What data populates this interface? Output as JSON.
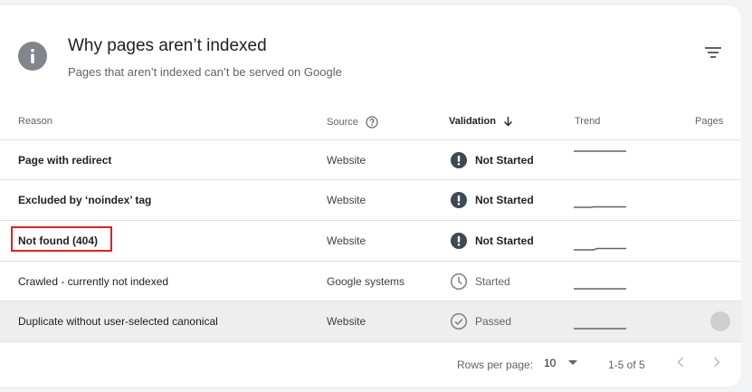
{
  "card": {
    "title": "Why pages aren’t indexed",
    "subtitle": "Pages that aren’t indexed can’t be served on Google",
    "info_icon": "info-icon",
    "filter_icon": "filter-icon"
  },
  "table": {
    "headers": {
      "reason": "Reason",
      "source": "Source",
      "validation": "Validation",
      "trend": "Trend",
      "pages": "Pages"
    },
    "rows": [
      {
        "reason": "Page with redirect",
        "source": "Website",
        "validation": "Not Started",
        "status_icon": "alert-icon"
      },
      {
        "reason": "Excluded by ‘noindex’ tag",
        "source": "Website",
        "validation": "Not Started",
        "status_icon": "alert-icon"
      },
      {
        "reason": "Not found (404)",
        "source": "Website",
        "validation": "Not Started",
        "status_icon": "alert-icon"
      },
      {
        "reason": "Crawled - currently not indexed",
        "source": "Google systems",
        "validation": "Started",
        "status_icon": "clock-icon"
      },
      {
        "reason": "Duplicate without user-selected canonical",
        "source": "Website",
        "validation": "Passed",
        "status_icon": "check-circle-icon"
      }
    ]
  },
  "pagination": {
    "rows_per_page_label": "Rows per page:",
    "rows_per_page_value": "10",
    "range": "1-5 of 5"
  },
  "colors": {
    "alert": "#3c4a55",
    "muted_icon": "#80868b",
    "highlight_box": "#e02020"
  }
}
